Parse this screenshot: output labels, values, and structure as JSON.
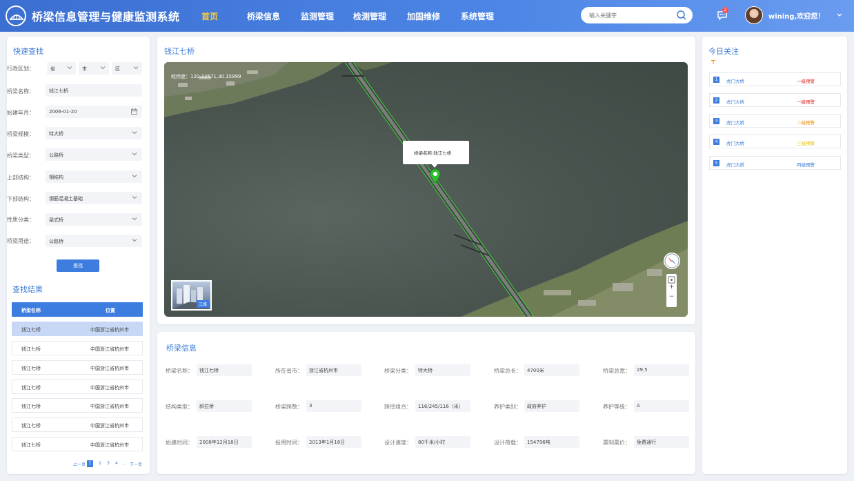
{
  "header": {
    "title": "桥梁信息管理与健康监测系统",
    "nav": [
      {
        "label": "首页",
        "active": true
      },
      {
        "label": "桥梁信息"
      },
      {
        "label": "监测管理"
      },
      {
        "label": "检测管理"
      },
      {
        "label": "加固维修"
      },
      {
        "label": "系统管理"
      }
    ],
    "search_placeholder": "输入关键字",
    "msg_count": "2",
    "user_greeting": "wining,欢迎您！"
  },
  "quick_search": {
    "title": "快速查找",
    "region_label": "行政区划：",
    "province": "省",
    "city": "市",
    "district": "区",
    "fields": [
      {
        "label": "桥梁名称：",
        "value": "钱江七桥",
        "kind": "text"
      },
      {
        "label": "始建年月：",
        "value": "2006-01-20",
        "kind": "date"
      },
      {
        "label": "桥梁规模：",
        "value": "特大桥",
        "kind": "select"
      },
      {
        "label": "桥梁类型：",
        "value": "公路桥",
        "kind": "select"
      },
      {
        "label": "上部结构：",
        "value": "钢结构",
        "kind": "select"
      },
      {
        "label": "下部结构：",
        "value": "钢筋混凝土基础",
        "kind": "select"
      },
      {
        "label": "性质分类：",
        "value": "梁式桥",
        "kind": "select"
      },
      {
        "label": "桥梁用途：",
        "value": "公路桥",
        "kind": "select"
      }
    ],
    "search_button": "查找"
  },
  "results": {
    "title": "查找结果",
    "columns": [
      "桥梁名称",
      "位置"
    ],
    "rows": [
      {
        "name": "钱江七桥",
        "location": "中国浙江省杭州市"
      },
      {
        "name": "钱江七桥",
        "location": "中国浙江省杭州市"
      },
      {
        "name": "钱江七桥",
        "location": "中国浙江省杭州市"
      },
      {
        "name": "钱江七桥",
        "location": "中国浙江省杭州市"
      },
      {
        "name": "钱江七桥",
        "location": "中国浙江省杭州市"
      },
      {
        "name": "钱江七桥",
        "location": "中国浙江省杭州市"
      },
      {
        "name": "钱江七桥",
        "location": "中国浙江省杭州市"
      }
    ],
    "pager": {
      "prev": "上一页",
      "pages": [
        "1",
        "2",
        "3",
        "4",
        "..."
      ],
      "next": "下一页"
    }
  },
  "map": {
    "title": "钱江七桥",
    "coords": "经纬度：120.12571,30.15899",
    "popup": "桥梁名称:钱江七桥",
    "thumb_label": "三维"
  },
  "bridge_info": {
    "title": "桥梁信息",
    "rows": [
      [
        {
          "label": "桥梁名称：",
          "value": "钱江七桥"
        },
        {
          "label": "所在省市：",
          "value": "浙江省杭州市"
        },
        {
          "label": "桥梁分类：",
          "value": "特大桥"
        },
        {
          "label": "桥梁总长：",
          "value": "4700米"
        },
        {
          "label": "桥梁总宽：",
          "value": "29.5"
        }
      ],
      [
        {
          "label": "结构类型：",
          "value": "斜拉桥"
        },
        {
          "label": "桥梁跨数：",
          "value": "3"
        },
        {
          "label": "跨径组合：",
          "value": "116/245/116（米）"
        },
        {
          "label": "养护类别：",
          "value": "政府养护"
        },
        {
          "label": "养护等级：",
          "value": "A"
        }
      ],
      [
        {
          "label": "始建时间：",
          "value": "2008年12月18日"
        },
        {
          "label": "投用时间：",
          "value": "2013年1月18日"
        },
        {
          "label": "设计速度：",
          "value": "80千米/小时"
        },
        {
          "label": "设计荷载：",
          "value": "154796吨"
        },
        {
          "label": "票制票价：",
          "value": "免费通行"
        }
      ]
    ]
  },
  "attention": {
    "title": "今日关注",
    "items": [
      {
        "num": "1",
        "name": "虎门大桥",
        "level": "一级预警",
        "color": "#e02020"
      },
      {
        "num": "2",
        "name": "虎门大桥",
        "level": "一级预警",
        "color": "#e02020"
      },
      {
        "num": "3",
        "name": "虎门大桥",
        "level": "二级预警",
        "color": "#f08c00"
      },
      {
        "num": "4",
        "name": "虎门大桥",
        "level": "三级预警",
        "color": "#e6c200"
      },
      {
        "num": "5",
        "name": "虎门大桥",
        "level": "四级预警",
        "color": "#3a7bd5"
      }
    ]
  }
}
